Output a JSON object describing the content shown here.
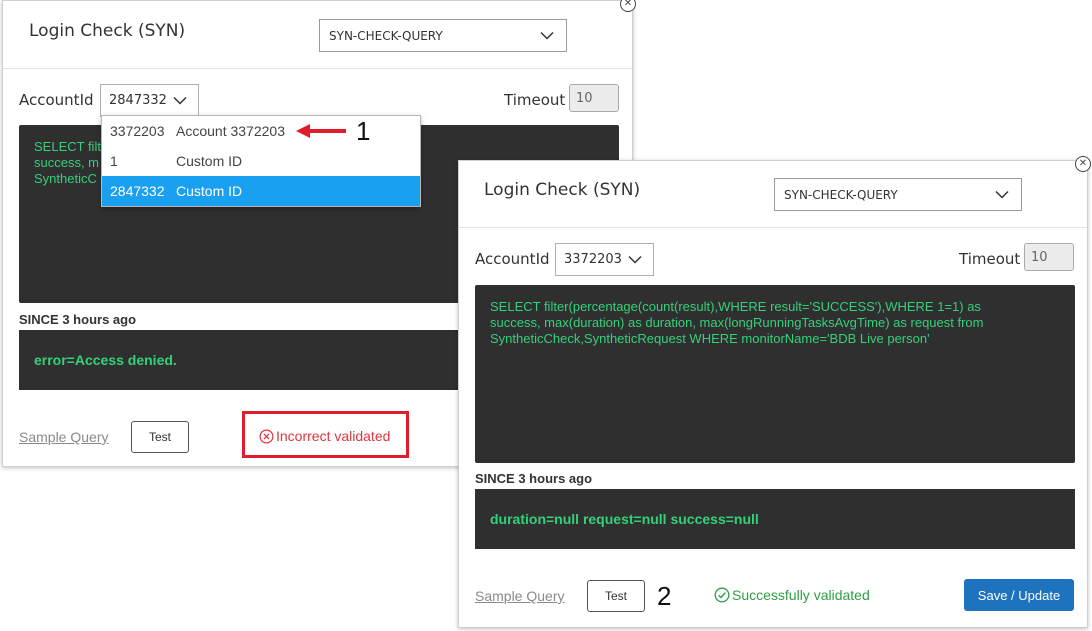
{
  "panel1": {
    "title": "Login Check (SYN)",
    "query_type": "SYN-CHECK-QUERY",
    "account_label": "AccountId",
    "account_value": "2847332",
    "timeout_label": "Timeout",
    "timeout_value": "10",
    "query_line1": "SELECT filt",
    "query_line2": "success, m",
    "query_line3": "SyntheticC",
    "since": "SINCE 3 hours ago",
    "result": "error=Access denied.",
    "sample_query": "Sample Query",
    "test_label": "Test",
    "status": "Incorrect validated",
    "status_color": "#e0353f",
    "dropdown": [
      {
        "id": "3372203",
        "name": "Account 3372203"
      },
      {
        "id": "1",
        "name": "Custom ID"
      },
      {
        "id": "2847332",
        "name": "Custom ID"
      }
    ]
  },
  "panel2": {
    "title": "Login Check (SYN)",
    "query_type": "SYN-CHECK-QUERY",
    "account_label": "AccountId",
    "account_value": "3372203",
    "timeout_label": "Timeout",
    "timeout_value": "10",
    "query_line1": "SELECT filter(percentage(count(result),WHERE result='SUCCESS'),WHERE 1=1) as",
    "query_line2": "success, max(duration) as duration, max(longRunningTasksAvgTime) as request from",
    "query_line3": "SyntheticCheck,SyntheticRequest WHERE monitorName='BDB Live person'",
    "since": "SINCE 3 hours ago",
    "result": "duration=null request=null success=null",
    "sample_query": "Sample Query",
    "test_label": "Test",
    "status": "Successfully validated",
    "status_color": "#2f9e44",
    "save_label": "Save / Update",
    "accent_color": "#1e73be"
  },
  "annotations": {
    "marker1": "1",
    "marker2": "2"
  }
}
